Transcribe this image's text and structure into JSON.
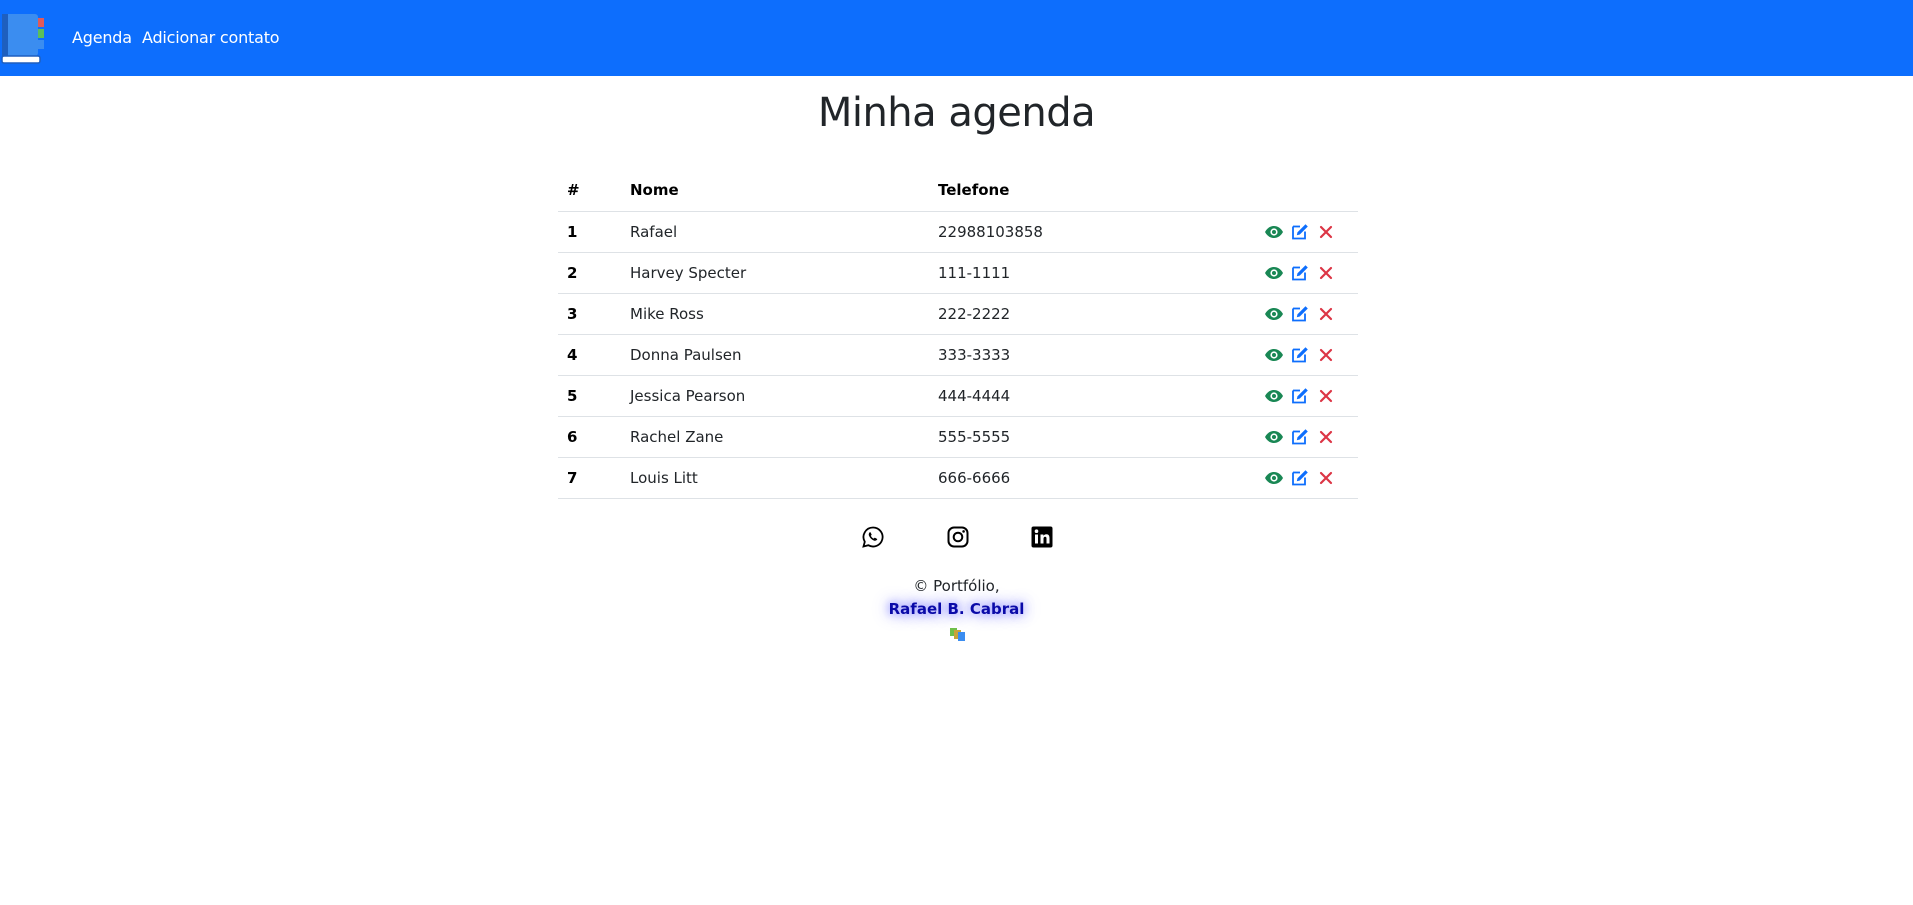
{
  "nav": {
    "logo": "agenda-book-logo",
    "links": [
      {
        "label": "Agenda"
      },
      {
        "label": "Adicionar contato"
      }
    ],
    "color": "#0d6efd"
  },
  "page": {
    "title": "Minha agenda"
  },
  "table": {
    "headers": {
      "num": "#",
      "name": "Nome",
      "phone": "Telefone"
    },
    "rows": [
      {
        "num": "1",
        "name": "Rafael",
        "phone": "22988103858"
      },
      {
        "num": "2",
        "name": "Harvey Specter",
        "phone": "111-1111"
      },
      {
        "num": "3",
        "name": "Mike Ross",
        "phone": "222-2222"
      },
      {
        "num": "4",
        "name": "Donna Paulsen",
        "phone": "333-3333"
      },
      {
        "num": "5",
        "name": "Jessica Pearson",
        "phone": "444-4444"
      },
      {
        "num": "6",
        "name": "Rachel Zane",
        "phone": "555-5555"
      },
      {
        "num": "7",
        "name": "Louis Litt",
        "phone": "666-6666"
      }
    ],
    "actions": [
      {
        "icon": "eye-icon",
        "color": "#198754"
      },
      {
        "icon": "edit-icon",
        "color": "#0d6efd"
      },
      {
        "icon": "close-icon",
        "color": "#dc3545"
      }
    ]
  },
  "social": [
    "whatsapp-icon",
    "instagram-icon",
    "linkedin-icon"
  ],
  "footer": {
    "copyright": "© Portfólio,",
    "author": "Rafael B. Cabral"
  }
}
